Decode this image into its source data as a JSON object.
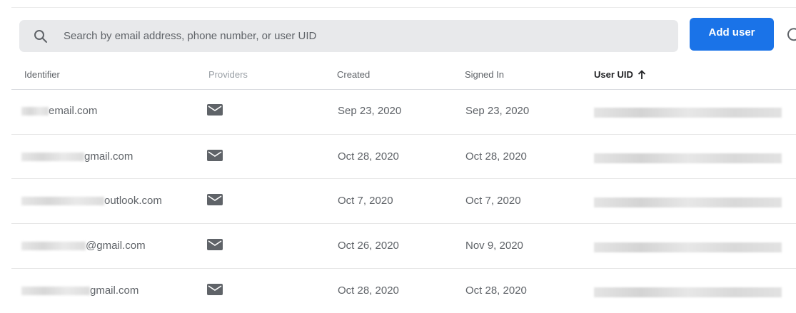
{
  "search": {
    "placeholder": "Search by email address, phone number, or user UID",
    "icon": "search-icon"
  },
  "toolbar": {
    "add_user_label": "Add user",
    "refresh_icon": "refresh-icon",
    "accent": "#1a73e8"
  },
  "table": {
    "columns": {
      "identifier": "Identifier",
      "providers": "Providers",
      "created": "Created",
      "signed_in": "Signed In",
      "user_uid": "User UID"
    },
    "sort": {
      "column": "User UID",
      "direction": "ascending",
      "icon": "arrow-up-icon"
    },
    "rows": [
      {
        "identifier_visible": "email.com",
        "provider_icon": "email-icon",
        "created": "Sep 23, 2020",
        "signed_in": "Sep 23, 2020"
      },
      {
        "identifier_visible": "gmail.com",
        "provider_icon": "email-icon",
        "created": "Oct 28, 2020",
        "signed_in": "Oct 28, 2020"
      },
      {
        "identifier_visible": "outlook.com",
        "provider_icon": "email-icon",
        "created": "Oct 7, 2020",
        "signed_in": "Oct 7, 2020"
      },
      {
        "identifier_visible": "@gmail.com",
        "provider_icon": "email-icon",
        "created": "Oct 26, 2020",
        "signed_in": "Nov 9, 2020"
      },
      {
        "identifier_visible": "gmail.com",
        "provider_icon": "email-icon",
        "created": "Oct 28, 2020",
        "signed_in": "Oct 28, 2020"
      }
    ]
  }
}
